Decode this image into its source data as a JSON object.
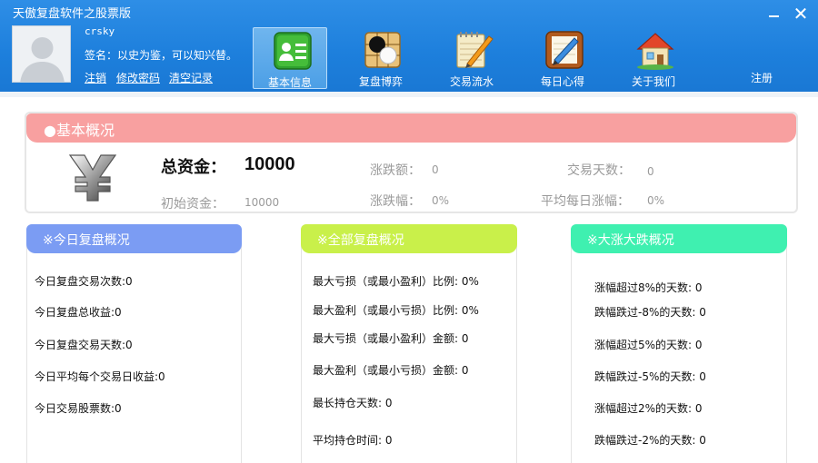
{
  "window": {
    "title": "天傲复盘软件之股票版"
  },
  "user": {
    "name": "crsky",
    "signature": "签名：以史为鉴，可以知兴替。",
    "links": {
      "logout": "注销",
      "change_password": "修改密码",
      "clear_records": "清空记录"
    }
  },
  "nav": {
    "tabs": [
      {
        "label": "基本信息",
        "icon": "contacts-card-icon",
        "active": true
      },
      {
        "label": "复盘博弈",
        "icon": "go-board-icon",
        "active": false
      },
      {
        "label": "交易流水",
        "icon": "notepad-pencil-icon",
        "active": false
      },
      {
        "label": "每日心得",
        "icon": "pencil-notebook-icon",
        "active": false
      },
      {
        "label": "关于我们",
        "icon": "house-icon",
        "active": false
      }
    ],
    "register": "注册"
  },
  "basic": {
    "title": "●基本概况",
    "total_assets_label": "总资金：",
    "total_assets_value": "10000",
    "initial_funds_label": "初始资金：",
    "initial_funds_value": "10000",
    "change_amount_label": "涨跌额：",
    "change_amount_value": "0",
    "change_percent_label": "涨跌幅：",
    "change_percent_value": "0%",
    "trade_days_label": "交易天数：",
    "trade_days_value": "0",
    "avg_daily_change_label": "平均每日涨幅：",
    "avg_daily_change_value": "0%"
  },
  "today_panel": {
    "title": "※今日复盘概况",
    "rows": [
      "今日复盘交易次数:0",
      "今日复盘总收益:0",
      "今日复盘交易天数:0",
      "今日平均每个交易日收益:0",
      "今日交易股票数:0"
    ]
  },
  "all_panel": {
    "title": "※全部复盘概况",
    "rows": [
      "最大亏损（或最小盈利）比例: 0%",
      "最大盈利（或最小亏损）比例: 0%",
      "最大亏损（或最小盈利）金额: 0",
      "最大盈利（或最小亏损）金额: 0",
      "最长持仓天数: 0",
      "平均持仓时间: 0"
    ]
  },
  "big_panel": {
    "title": "※大涨大跌概况",
    "rows": [
      "涨幅超过8%的天数: 0",
      "跌幅跌过-8%的天数: 0",
      "涨幅超过5%的天数: 0",
      "跌幅跌过-5%的天数: 0",
      "涨幅超过2%的天数: 0",
      "跌幅跌过-2%的天数: 0"
    ]
  },
  "colors": {
    "header": "#1d7fdc",
    "basic_title": "#f8a0a0",
    "today_title": "#7b9cf3",
    "all_title": "#c9f04a",
    "big_title": "#3ff0b0"
  }
}
